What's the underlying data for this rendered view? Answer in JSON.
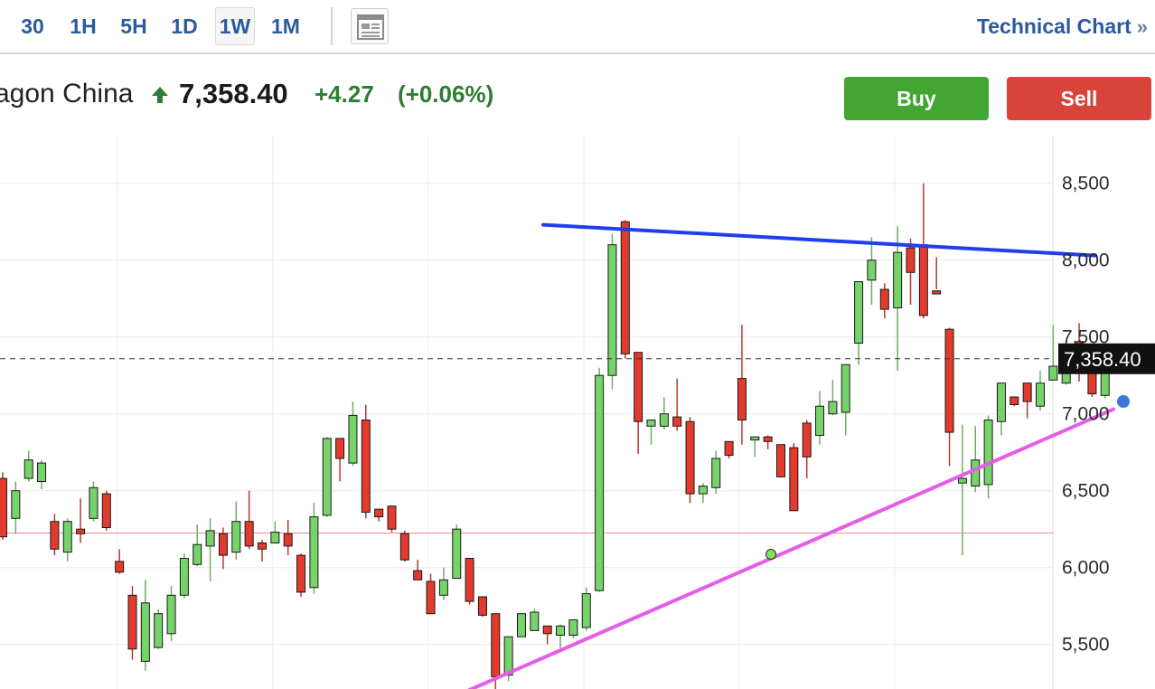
{
  "toolbar": {
    "timeframes": [
      "30",
      "1H",
      "5H",
      "1D",
      "1W",
      "1M"
    ],
    "active_timeframe": "1W",
    "layout_icon": "chart-layout-icon",
    "technical_chart_label": "Technical Chart",
    "technical_chart_chevron": "»"
  },
  "quote": {
    "name": "agon China",
    "direction_icon": "arrow-up-icon",
    "price": "7,358.40",
    "change": "+4.27",
    "change_pct": "(+0.06%)"
  },
  "actions": {
    "buy_label": "Buy",
    "sell_label": "Sell"
  },
  "colors": {
    "up": "#76d36a",
    "down": "#e23b2e",
    "trendline_top": "#1f3fef",
    "trendline_bottom": "#e45ce8",
    "accent_link": "#2a5a9c",
    "buy": "#44a632",
    "sell": "#d9443a"
  },
  "chart_data": {
    "type": "candlestick",
    "y_axis": {
      "ticks": [
        5500,
        6000,
        6500,
        7000,
        7500,
        8000,
        8500
      ],
      "tick_labels": [
        "5,500",
        "6,000",
        "6,500",
        "7,000",
        "7,500",
        "8,000",
        "8,500"
      ],
      "position": "right",
      "visible_range": [
        5210,
        8810
      ]
    },
    "last_price": 7358.4,
    "last_price_label": "7,358.40",
    "reference_level": 6225,
    "grid": true,
    "candles": [
      [
        6580,
        6200,
        6620,
        6180
      ],
      [
        6320,
        6500,
        6560,
        6220
      ],
      [
        6580,
        6700,
        6760,
        6560
      ],
      [
        6560,
        6680,
        6700,
        6510
      ],
      [
        6300,
        6120,
        6350,
        6080
      ],
      [
        6100,
        6300,
        6320,
        6040
      ],
      [
        6250,
        6220,
        6450,
        6160
      ],
      [
        6320,
        6520,
        6560,
        6300
      ],
      [
        6480,
        6260,
        6500,
        6240
      ],
      [
        6040,
        5970,
        6120,
        5960
      ],
      [
        5820,
        5470,
        5880,
        5400
      ],
      [
        5390,
        5770,
        5920,
        5330
      ],
      [
        5480,
        5700,
        5730,
        5470
      ],
      [
        5570,
        5820,
        5880,
        5520
      ],
      [
        5820,
        6060,
        6090,
        5800
      ],
      [
        6020,
        6150,
        6280,
        6010
      ],
      [
        6140,
        6240,
        6320,
        5910
      ],
      [
        6220,
        6080,
        6260,
        5990
      ],
      [
        6100,
        6300,
        6430,
        6050
      ],
      [
        6300,
        6140,
        6500,
        6120
      ],
      [
        6160,
        6120,
        6180,
        6040
      ],
      [
        6160,
        6230,
        6300,
        6160
      ],
      [
        6220,
        6140,
        6310,
        6080
      ],
      [
        6080,
        5840,
        6090,
        5810
      ],
      [
        5870,
        6330,
        6420,
        5830
      ],
      [
        6340,
        6840,
        6850,
        6330
      ],
      [
        6840,
        6710,
        6750,
        6560
      ],
      [
        6680,
        6990,
        7080,
        6660
      ],
      [
        6960,
        6360,
        7060,
        6320
      ],
      [
        6380,
        6330,
        6370,
        6300
      ],
      [
        6400,
        6250,
        6390,
        6230
      ],
      [
        6220,
        6050,
        6240,
        6040
      ],
      [
        5980,
        5920,
        6050,
        5920
      ],
      [
        5910,
        5700,
        5960,
        5700
      ],
      [
        5820,
        5920,
        6000,
        5790
      ],
      [
        5930,
        6250,
        6280,
        5940
      ],
      [
        6060,
        5780,
        6060,
        5760
      ],
      [
        5810,
        5690,
        5790,
        5680
      ],
      [
        5700,
        5290,
        5600,
        5100
      ],
      [
        5300,
        5550,
        5440,
        5260
      ],
      [
        5550,
        5700,
        5700,
        5580
      ],
      [
        5590,
        5710,
        5730,
        5590
      ],
      [
        5620,
        5570,
        5610,
        5500
      ],
      [
        5560,
        5620,
        5630,
        5450
      ],
      [
        5560,
        5660,
        5640,
        5540
      ],
      [
        5610,
        5830,
        5870,
        5590
      ],
      [
        5850,
        7250,
        7300,
        5840
      ],
      [
        7250,
        8100,
        8170,
        7160
      ],
      [
        8250,
        7390,
        8260,
        7360
      ],
      [
        7400,
        6950,
        7330,
        6740
      ],
      [
        6920,
        6960,
        6960,
        6800
      ],
      [
        6920,
        7000,
        7110,
        6900
      ],
      [
        6980,
        6920,
        7230,
        6890
      ],
      [
        6950,
        6480,
        6980,
        6420
      ],
      [
        6480,
        6530,
        6550,
        6420
      ],
      [
        6520,
        6710,
        6760,
        6480
      ],
      [
        6820,
        6730,
        6790,
        6710
      ],
      [
        7230,
        6960,
        7580,
        6800
      ],
      [
        6830,
        6850,
        6840,
        6720
      ],
      [
        6850,
        6820,
        6860,
        6770
      ],
      [
        6800,
        6590,
        6800,
        6620
      ],
      [
        6780,
        6370,
        6810,
        6370
      ],
      [
        6940,
        6720,
        6960,
        6580
      ],
      [
        6860,
        7050,
        7150,
        6800
      ],
      [
        7000,
        7080,
        7220,
        6990
      ],
      [
        7010,
        7320,
        7320,
        6860
      ],
      [
        7460,
        7860,
        7580,
        7320
      ],
      [
        7870,
        8000,
        8150,
        7710
      ],
      [
        7810,
        7680,
        7850,
        7620
      ],
      [
        7690,
        8050,
        8220,
        7280
      ],
      [
        8080,
        7920,
        8140,
        7710
      ],
      [
        8100,
        7640,
        8500,
        7620
      ],
      [
        7800,
        7780,
        8020,
        7810
      ],
      [
        7550,
        6880,
        7560,
        6660
      ],
      [
        6550,
        6580,
        6930,
        6080
      ],
      [
        6530,
        6700,
        6920,
        6490
      ],
      [
        6540,
        6960,
        6990,
        6450
      ],
      [
        6950,
        7200,
        7200,
        6860
      ],
      [
        7110,
        7060,
        7090,
        7050
      ],
      [
        7200,
        7080,
        7080,
        6970
      ],
      [
        7050,
        7200,
        7280,
        7020
      ],
      [
        7220,
        7310,
        7580,
        7290
      ],
      [
        7200,
        7330,
        7360,
        7190
      ],
      [
        7470,
        7380,
        7590,
        7210
      ],
      [
        7340,
        7130,
        7340,
        7110
      ],
      [
        7120,
        7380,
        7450,
        7100
      ],
      [
        7360,
        7360,
        7380,
        7320
      ]
    ],
    "trendlines": [
      {
        "name": "",
        "color": "#1f3fef",
        "points": [
          [
            0,
            8230
          ],
          [
            1,
            8030
          ]
        ]
      },
      {
        "name": "",
        "color": "#e45ce8",
        "points": [
          [
            0,
            5200
          ],
          [
            1,
            7030
          ]
        ]
      }
    ]
  }
}
